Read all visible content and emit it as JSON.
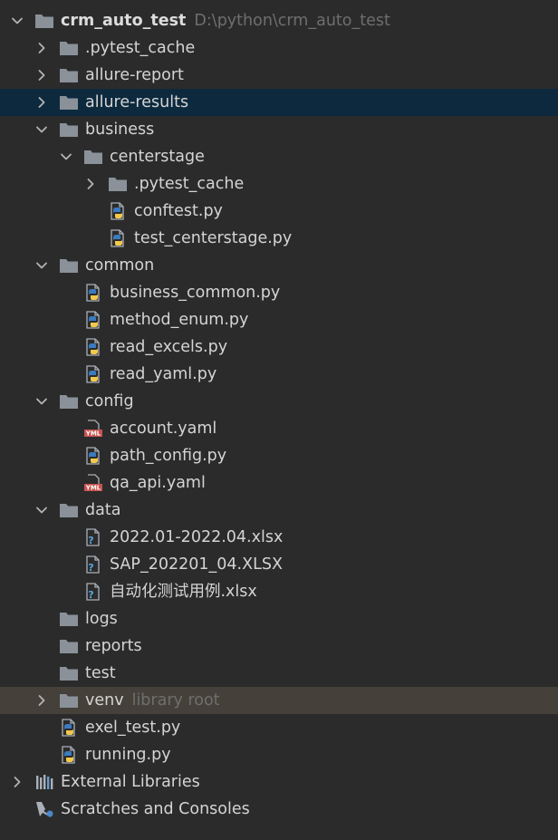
{
  "colors": {
    "background": "#2b2b2b",
    "selected_row": "#0d293e",
    "library_root_row": "#45413a",
    "folder": "#8a9199",
    "python_blue": "#3b7bbf",
    "python_yellow": "#f2c94c",
    "yaml_red": "#c75450",
    "hint_text": "#6e6e6e"
  },
  "tree": [
    {
      "label": "crm_auto_test",
      "hint": "D:\\python\\crm_auto_test",
      "type": "folder",
      "depth": 0,
      "expanded": true,
      "bold": true
    },
    {
      "label": ".pytest_cache",
      "type": "folder",
      "depth": 1,
      "expanded": false
    },
    {
      "label": "allure-report",
      "type": "folder",
      "depth": 1,
      "expanded": false
    },
    {
      "label": "allure-results",
      "type": "folder",
      "depth": 1,
      "expanded": false,
      "selected": true
    },
    {
      "label": "business",
      "type": "folder",
      "depth": 1,
      "expanded": true
    },
    {
      "label": "centerstage",
      "type": "folder",
      "depth": 2,
      "expanded": true
    },
    {
      "label": ".pytest_cache",
      "type": "folder",
      "depth": 3,
      "expanded": false
    },
    {
      "label": "conftest.py",
      "type": "python",
      "depth": 3
    },
    {
      "label": "test_centerstage.py",
      "type": "python",
      "depth": 3
    },
    {
      "label": "common",
      "type": "folder",
      "depth": 1,
      "expanded": true
    },
    {
      "label": "business_common.py",
      "type": "python",
      "depth": 2
    },
    {
      "label": "method_enum.py",
      "type": "python",
      "depth": 2
    },
    {
      "label": "read_excels.py",
      "type": "python",
      "depth": 2
    },
    {
      "label": "read_yaml.py",
      "type": "python",
      "depth": 2
    },
    {
      "label": "config",
      "type": "folder",
      "depth": 1,
      "expanded": true
    },
    {
      "label": "account.yaml",
      "type": "yaml",
      "depth": 2
    },
    {
      "label": "path_config.py",
      "type": "python",
      "depth": 2
    },
    {
      "label": "qa_api.yaml",
      "type": "yaml",
      "depth": 2
    },
    {
      "label": "data",
      "type": "folder",
      "depth": 1,
      "expanded": true
    },
    {
      "label": "2022.01-2022.04.xlsx",
      "type": "unknown",
      "depth": 2
    },
    {
      "label": "SAP_202201_04.XLSX",
      "type": "unknown",
      "depth": 2
    },
    {
      "label": "自动化测试用例.xlsx",
      "type": "unknown",
      "depth": 2
    },
    {
      "label": "logs",
      "type": "folder",
      "depth": 1
    },
    {
      "label": "reports",
      "type": "folder",
      "depth": 1
    },
    {
      "label": "test",
      "type": "folder",
      "depth": 1
    },
    {
      "label": "venv",
      "hint": "library root",
      "type": "folder",
      "depth": 1,
      "expanded": false,
      "library_root": true
    },
    {
      "label": "exel_test.py",
      "type": "python",
      "depth": 1
    },
    {
      "label": "running.py",
      "type": "python",
      "depth": 1
    },
    {
      "label": "External Libraries",
      "type": "libraries",
      "depth": 0,
      "expanded": false
    },
    {
      "label": "Scratches and Consoles",
      "type": "scratches",
      "depth": 0
    }
  ],
  "yaml_icon_text": "YML"
}
